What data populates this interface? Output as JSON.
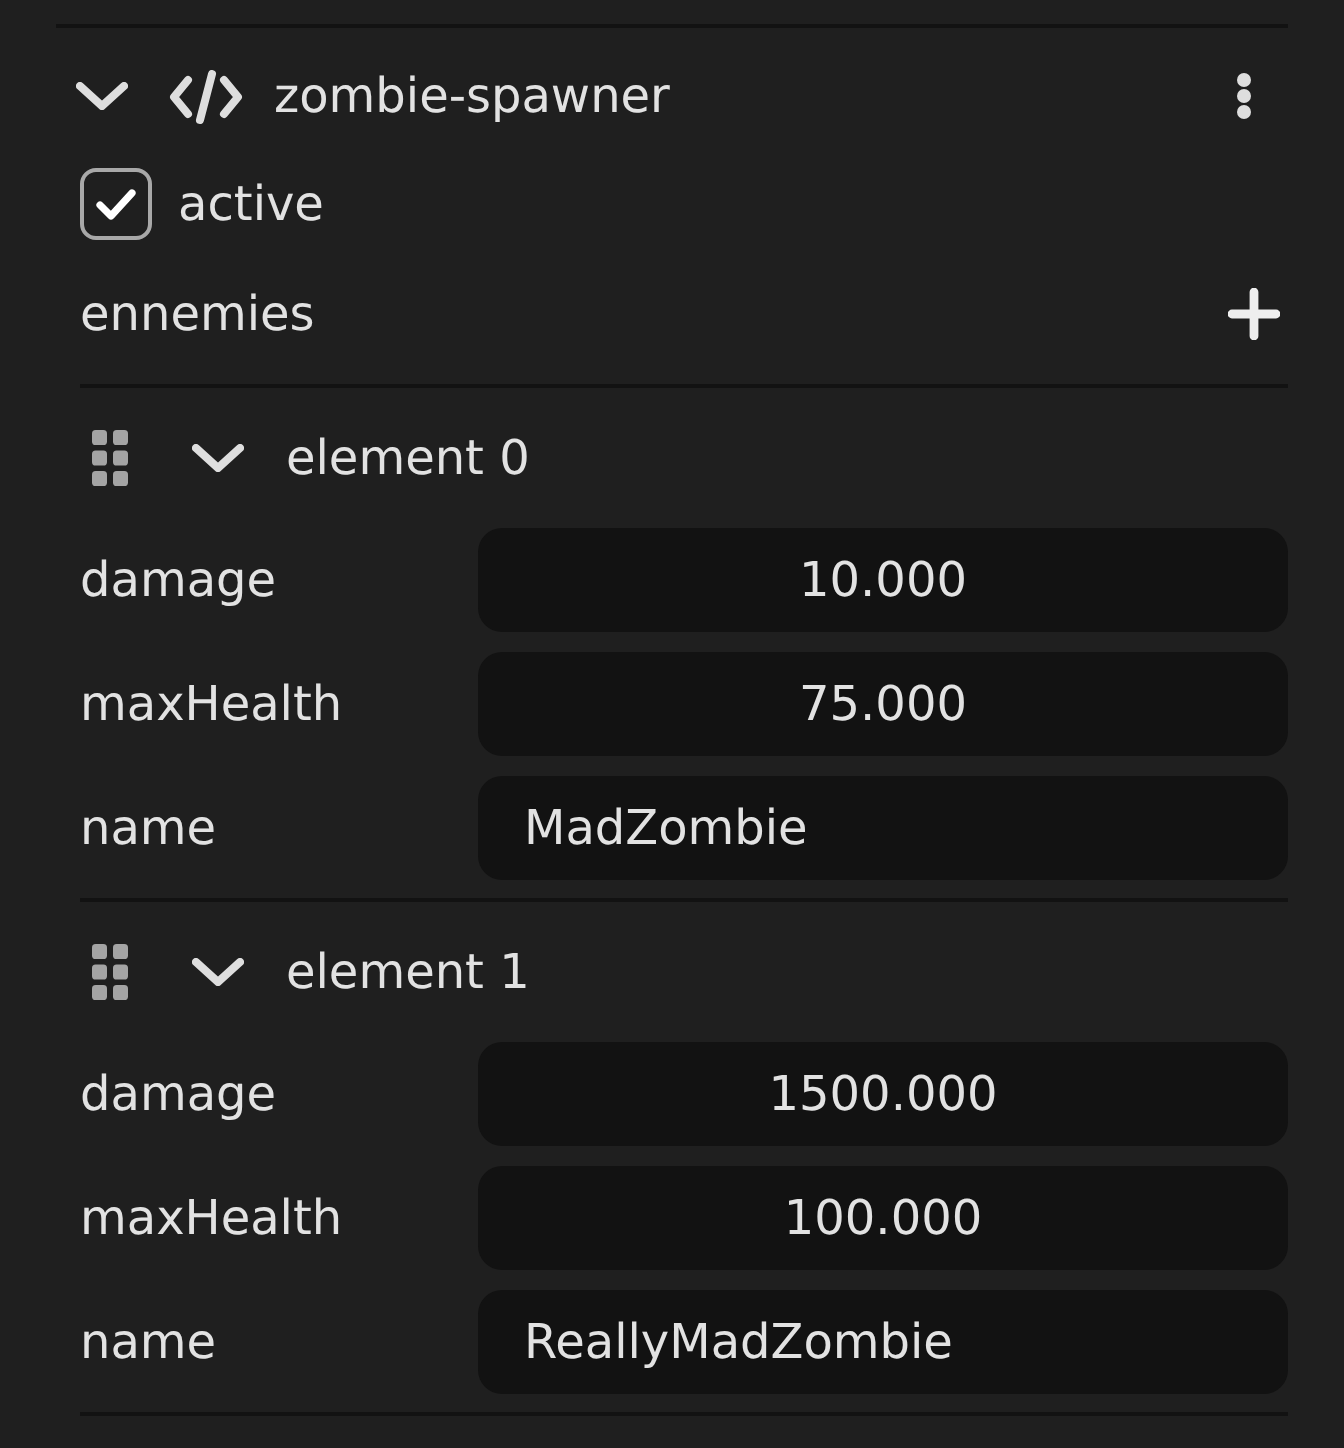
{
  "component": {
    "title": "zombie-spawner",
    "expanded": true,
    "active": {
      "label": "active",
      "checked": true
    },
    "list": {
      "label": "ennemies",
      "elements": [
        {
          "title": "element 0",
          "expanded": true,
          "fields": [
            {
              "label": "damage",
              "value": "10.000",
              "kind": "number"
            },
            {
              "label": "maxHealth",
              "value": "75.000",
              "kind": "number"
            },
            {
              "label": "name",
              "value": "MadZombie",
              "kind": "text"
            }
          ]
        },
        {
          "title": "element 1",
          "expanded": true,
          "fields": [
            {
              "label": "damage",
              "value": "1500.000",
              "kind": "number"
            },
            {
              "label": "maxHealth",
              "value": "100.000",
              "kind": "number"
            },
            {
              "label": "name",
              "value": "ReallyMadZombie",
              "kind": "text"
            }
          ]
        }
      ]
    }
  }
}
